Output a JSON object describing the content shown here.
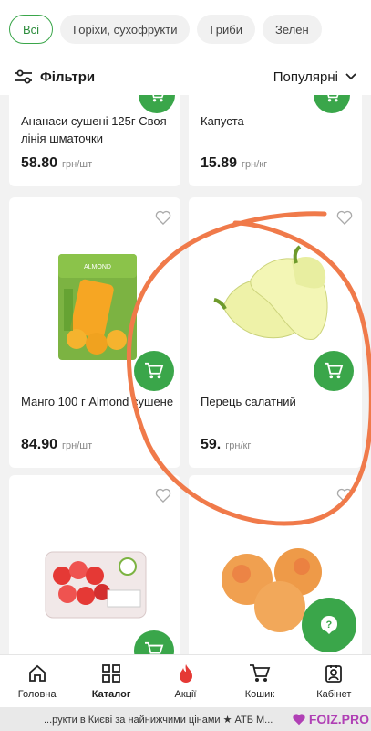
{
  "categories": [
    "Всі",
    "Горіхи, сухофрукти",
    "Гриби",
    "Зелен"
  ],
  "filter_label": "Фільтри",
  "sort_label": "Популярні",
  "products": [
    {
      "name": "Ананаси сушені 125г Своя лінія шматочки",
      "price": "58.80",
      "unit": "грн/шт"
    },
    {
      "name": "Капуста",
      "price": "15.89",
      "unit": "грн/кг"
    },
    {
      "name": "Манго 100 г Almond сушене",
      "price": "84.90",
      "unit": "грн/шт"
    },
    {
      "name": "Перець салатний",
      "price": "59.",
      "unit": "грн/кг"
    }
  ],
  "nav": [
    {
      "label": "Головна",
      "icon": "home-icon"
    },
    {
      "label": "Каталог",
      "icon": "grid-icon"
    },
    {
      "label": "Акції",
      "icon": "fire-icon"
    },
    {
      "label": "Кошик",
      "icon": "cart-icon"
    },
    {
      "label": "Кабінет",
      "icon": "profile-icon"
    }
  ],
  "ticker": "...рукти в Києві за найнижчими цінами ★ АТБ М...",
  "watermark": "FOIZ.PRO",
  "colors": {
    "accent": "#3aa64a",
    "annotation": "#f07a4a",
    "watermark": "#b040b5"
  }
}
